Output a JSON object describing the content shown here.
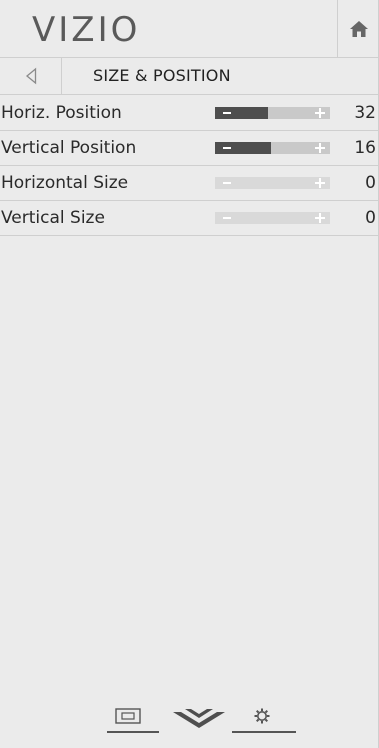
{
  "header": {
    "logo_text": "VIZIO",
    "home_icon": "home-icon"
  },
  "titlebar": {
    "back_icon": "back-arrow-icon",
    "title": "SIZE & POSITION"
  },
  "settings": [
    {
      "label": "Horiz. Position",
      "value": "32",
      "level": 0.46,
      "active": true
    },
    {
      "label": "Vertical Position",
      "value": "16",
      "level": 0.49,
      "active": true
    },
    {
      "label": "Horizontal Size",
      "value": "0",
      "level": 0,
      "active": false
    },
    {
      "label": "Vertical Size",
      "value": "0",
      "level": 0,
      "active": false
    }
  ],
  "bottom_nav": {
    "items": [
      "input-icon",
      "vizio-v-icon",
      "gear-icon"
    ]
  },
  "colors": {
    "background": "#ebebeb",
    "slider_fill": "#4e4e4e",
    "slider_track": "#c9c9c9",
    "divider": "#cfcfcf"
  }
}
